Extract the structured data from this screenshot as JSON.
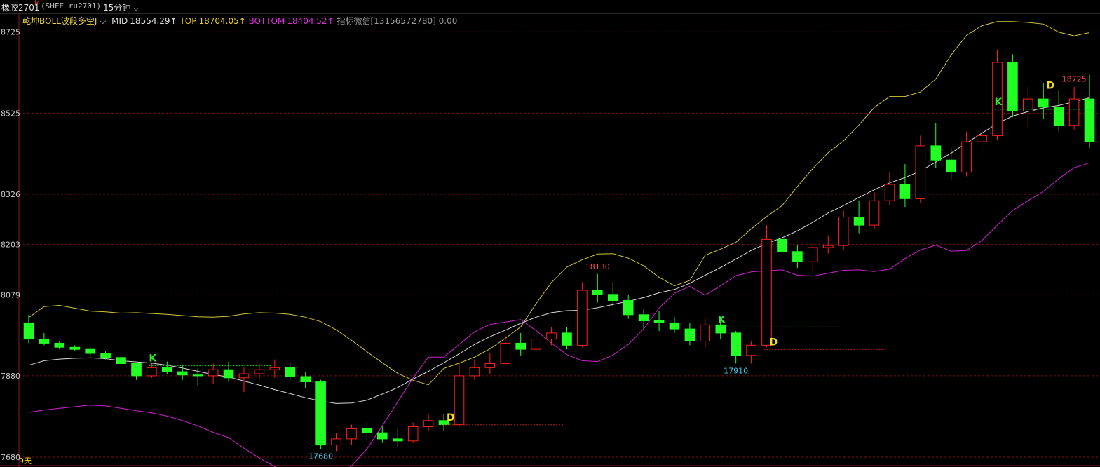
{
  "header": {
    "symbol": "橡胶2701",
    "symbol_flag": "M",
    "exchange": "(SHFE ru2701)",
    "period": "15分钟"
  },
  "indicator": {
    "name": "乾坤BOLL波段多空J",
    "mid_label": "MID",
    "mid_value": "18554.29↑",
    "top_label": "TOP",
    "top_value": "18704.05↑",
    "bottom_label": "BOTTOM",
    "bottom_value": "18404.52↑",
    "contact": "指标微信[13156572780] 0.00"
  },
  "colors": {
    "up": "#ff2020",
    "down": "#22ff22",
    "top": "#d4c43a",
    "mid": "#d8d8d8",
    "bottom": "#d020d0",
    "grid": "#7a1010"
  },
  "chart_data": {
    "type": "candlestick",
    "ylim": [
      17680,
      18760
    ],
    "y_ticks": [
      18725,
      18525,
      18326,
      18203,
      18079,
      17880,
      17680
    ],
    "y_tick_labels": [
      "8725",
      "8525",
      "8326",
      "8203",
      "8079",
      "7880",
      "7680"
    ],
    "bottom_left_label": "9天",
    "series": [
      {
        "name": "TOP",
        "values": [
          18023,
          18050,
          18053,
          18046,
          18039,
          18037,
          18034,
          18035,
          18033,
          18031,
          18028,
          18025,
          18024,
          18026,
          18032,
          18035,
          18034,
          18031,
          18024,
          18013,
          17993,
          17967,
          17939,
          17912,
          17886,
          17869,
          17858,
          17898,
          17911,
          17926,
          17946,
          17972,
          18000,
          18057,
          18109,
          18147,
          18165,
          18179,
          18180,
          18169,
          18150,
          18122,
          18101,
          18114,
          18176,
          18191,
          18208,
          18241,
          18271,
          18298,
          18345,
          18389,
          18428,
          18457,
          18496,
          18539,
          18566,
          18566,
          18577,
          18609,
          18668,
          18716,
          18740,
          18750,
          18750,
          18748,
          18744,
          18724,
          18715,
          18723
        ]
      },
      {
        "name": "MID",
        "values": [
          17906,
          17917,
          17921,
          17923,
          17924,
          17922,
          17917,
          17914,
          17911,
          17906,
          17899,
          17891,
          17883,
          17877,
          17867,
          17857,
          17846,
          17836,
          17826,
          17818,
          17812,
          17813,
          17820,
          17835,
          17851,
          17872,
          17891,
          17912,
          17934,
          17957,
          17976,
          17992,
          18009,
          18024,
          18035,
          18040,
          18041,
          18047,
          18055,
          18063,
          18072,
          18084,
          18092,
          18107,
          18127,
          18146,
          18167,
          18188,
          18205,
          18219,
          18236,
          18257,
          18280,
          18298,
          18318,
          18337,
          18354,
          18367,
          18383,
          18405,
          18427,
          18452,
          18476,
          18500,
          18518,
          18529,
          18538,
          18544,
          18553,
          18563
        ]
      },
      {
        "name": "BOTTOM",
        "values": [
          17790,
          17796,
          17800,
          17804,
          17808,
          17806,
          17800,
          17794,
          17789,
          17781,
          17770,
          17757,
          17741,
          17728,
          17702,
          17678,
          17657,
          17640,
          17627,
          17624,
          17631,
          17659,
          17700,
          17757,
          17816,
          17875,
          17926,
          17926,
          17957,
          17988,
          18006,
          18012,
          18018,
          17991,
          17960,
          17932,
          17917,
          17915,
          17931,
          17957,
          17995,
          18046,
          18083,
          18100,
          18078,
          18101,
          18126,
          18135,
          18138,
          18140,
          18127,
          18125,
          18132,
          18139,
          18140,
          18136,
          18142,
          18168,
          18189,
          18201,
          18186,
          18188,
          18212,
          18250,
          18286,
          18310,
          18333,
          18364,
          18391,
          18403
        ]
      }
    ],
    "candles": [
      [
        18010,
        18030,
        17960,
        17970
      ],
      [
        17970,
        17985,
        17955,
        17960
      ],
      [
        17960,
        17965,
        17945,
        17950
      ],
      [
        17950,
        17955,
        17940,
        17945
      ],
      [
        17945,
        17950,
        17930,
        17935
      ],
      [
        17935,
        17940,
        17920,
        17925
      ],
      [
        17925,
        17930,
        17905,
        17910
      ],
      [
        17910,
        17912,
        17870,
        17880
      ],
      [
        17880,
        17910,
        17875,
        17900
      ],
      [
        17900,
        17915,
        17885,
        17890
      ],
      [
        17890,
        17905,
        17870,
        17882
      ],
      [
        17882,
        17898,
        17855,
        17880
      ],
      [
        17880,
        17910,
        17860,
        17895
      ],
      [
        17895,
        17915,
        17865,
        17875
      ],
      [
        17875,
        17900,
        17840,
        17885
      ],
      [
        17885,
        17910,
        17870,
        17895
      ],
      [
        17895,
        17920,
        17875,
        17900
      ],
      [
        17900,
        17910,
        17870,
        17878
      ],
      [
        17878,
        17890,
        17850,
        17865
      ],
      [
        17865,
        17870,
        17700,
        17710
      ],
      [
        17710,
        17740,
        17695,
        17725
      ],
      [
        17725,
        17760,
        17710,
        17750
      ],
      [
        17750,
        17765,
        17720,
        17740
      ],
      [
        17740,
        17755,
        17715,
        17725
      ],
      [
        17725,
        17750,
        17705,
        17720
      ],
      [
        17720,
        17765,
        17715,
        17755
      ],
      [
        17755,
        17785,
        17745,
        17770
      ],
      [
        17770,
        17785,
        17745,
        17760
      ],
      [
        17760,
        17910,
        17755,
        17880
      ],
      [
        17880,
        17920,
        17870,
        17900
      ],
      [
        17900,
        17935,
        17885,
        17910
      ],
      [
        17910,
        17980,
        17905,
        17960
      ],
      [
        17960,
        17985,
        17930,
        17945
      ],
      [
        17945,
        17990,
        17935,
        17970
      ],
      [
        17970,
        18000,
        17955,
        17985
      ],
      [
        17985,
        18000,
        17945,
        17955
      ],
      [
        17955,
        18110,
        17950,
        18090
      ],
      [
        18090,
        18130,
        18060,
        18080
      ],
      [
        18080,
        18110,
        18050,
        18065
      ],
      [
        18065,
        18080,
        18020,
        18030
      ],
      [
        18030,
        18045,
        17995,
        18015
      ],
      [
        18015,
        18040,
        17990,
        18010
      ],
      [
        18010,
        18025,
        17985,
        17995
      ],
      [
        17995,
        18010,
        17955,
        17965
      ],
      [
        17965,
        18020,
        17950,
        18005
      ],
      [
        18005,
        18025,
        17970,
        17985
      ],
      [
        17985,
        17990,
        17910,
        17930
      ],
      [
        17930,
        17965,
        17910,
        17955
      ],
      [
        17955,
        18250,
        17950,
        18215
      ],
      [
        18215,
        18240,
        18175,
        18185
      ],
      [
        18185,
        18200,
        18145,
        18160
      ],
      [
        18160,
        18205,
        18135,
        18195
      ],
      [
        18195,
        18225,
        18180,
        18200
      ],
      [
        18200,
        18285,
        18190,
        18270
      ],
      [
        18270,
        18310,
        18230,
        18250
      ],
      [
        18250,
        18330,
        18240,
        18310
      ],
      [
        18310,
        18380,
        18300,
        18350
      ],
      [
        18350,
        18400,
        18295,
        18315
      ],
      [
        18315,
        18470,
        18305,
        18445
      ],
      [
        18445,
        18500,
        18390,
        18410
      ],
      [
        18410,
        18440,
        18360,
        18380
      ],
      [
        18380,
        18480,
        18370,
        18455
      ],
      [
        18455,
        18520,
        18420,
        18470
      ],
      [
        18470,
        18680,
        18460,
        18650
      ],
      [
        18650,
        18670,
        18515,
        18530
      ],
      [
        18530,
        18590,
        18490,
        18560
      ],
      [
        18560,
        18600,
        18510,
        18540
      ],
      [
        18540,
        18580,
        18480,
        18495
      ],
      [
        18495,
        18590,
        18485,
        18560
      ],
      [
        18560,
        18620,
        18440,
        18455
      ]
    ],
    "high_low_labels": [
      {
        "text": "18130",
        "kind": "high",
        "index": 37
      },
      {
        "text": "17680",
        "kind": "low",
        "index": 19
      },
      {
        "text": "17910",
        "kind": "low",
        "index": 46
      },
      {
        "text": "18725",
        "kind": "high",
        "index": 68
      }
    ],
    "signals": [
      {
        "text": "K",
        "index": 8,
        "price": 17915,
        "color": "#2ee62e"
      },
      {
        "text": "D",
        "index": 27,
        "price": 17770,
        "color": "#f0e020"
      },
      {
        "text": "K",
        "index": 45,
        "price": 18010,
        "color": "#2ee62e"
      },
      {
        "text": "D",
        "index": 48,
        "price": 17955,
        "color": "#f0e020"
      },
      {
        "text": "K",
        "index": 63,
        "price": 18545,
        "color": "#2ee62e"
      },
      {
        "text": "D",
        "index": 66,
        "price": 18585,
        "color": "#f0e020"
      }
    ]
  }
}
